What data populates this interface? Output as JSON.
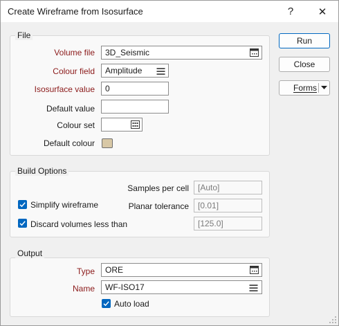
{
  "window": {
    "title": "Create Wireframe from Isosurface",
    "help_label": "?",
    "close_label": "✕"
  },
  "buttons": {
    "run": "Run",
    "close": "Close",
    "forms": "Forms"
  },
  "file_group": {
    "label": "File",
    "volume_file_label": "Volume file",
    "volume_file_value": "3D_Seismic",
    "colour_field_label": "Colour field",
    "colour_field_value": "Amplitude",
    "isosurface_value_label": "Isosurface value",
    "isosurface_value_value": "0",
    "default_value_label": "Default value",
    "default_value_value": "",
    "colour_set_label": "Colour set",
    "colour_set_value": "",
    "default_colour_label": "Default colour",
    "default_colour_swatch": "#d8c8a6"
  },
  "build_group": {
    "label": "Build Options",
    "samples_per_cell_label": "Samples per cell",
    "samples_per_cell_value": "[Auto]",
    "simplify_label": "Simplify wireframe",
    "simplify_checked": true,
    "planar_tolerance_label": "Planar tolerance",
    "planar_tolerance_value": "[0.01]",
    "discard_label": "Discard volumes less than",
    "discard_checked": true,
    "discard_value": "[125.0]"
  },
  "output_group": {
    "label": "Output",
    "type_label": "Type",
    "type_value": "ORE",
    "name_label": "Name",
    "name_value": "WF-ISO17",
    "auto_load_label": "Auto load",
    "auto_load_checked": true
  },
  "colors": {
    "accent": "#0067c0",
    "required_label": "#8b1a1a"
  }
}
